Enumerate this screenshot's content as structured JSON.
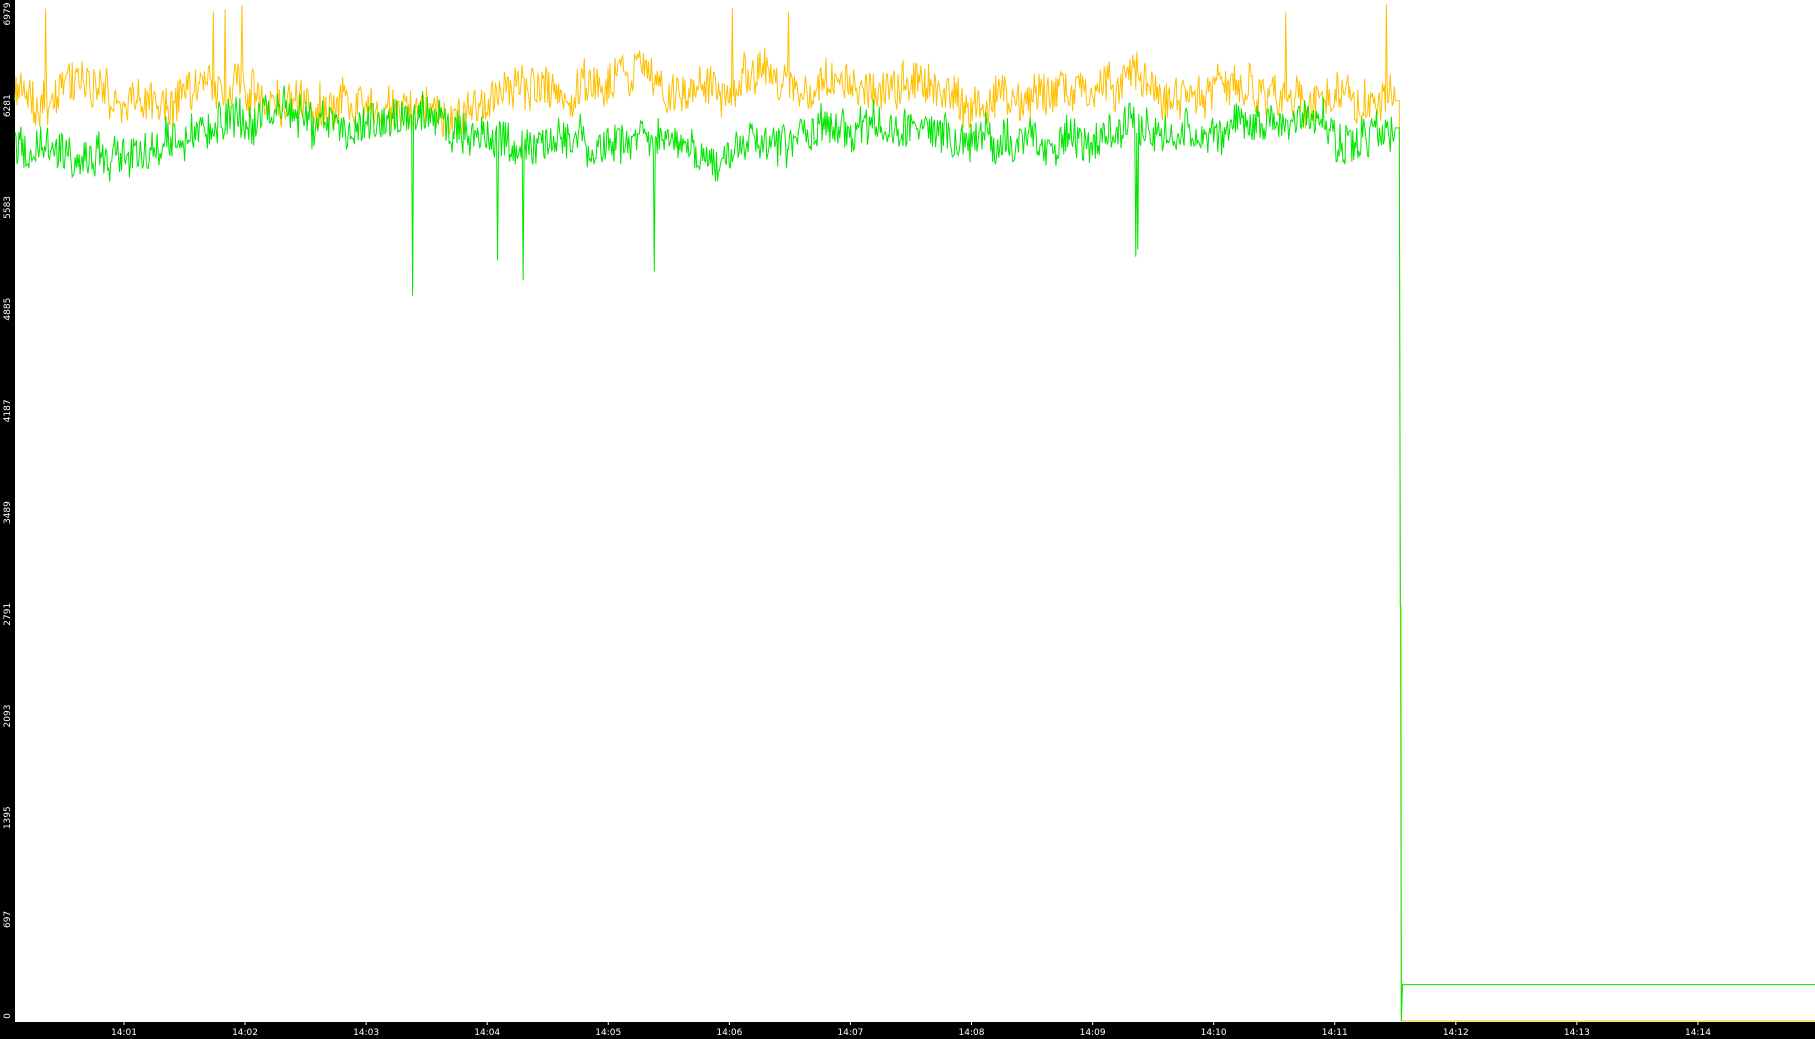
{
  "chart_data": {
    "type": "line",
    "title": "",
    "xlabel": "",
    "ylabel": "",
    "ylim": [
      0,
      6979
    ],
    "y_ticks": [
      "0",
      "697",
      "1395",
      "2093",
      "2791",
      "3489",
      "4187",
      "4885",
      "5583",
      "6281",
      "6979"
    ],
    "x_ticks": [
      "14:01",
      "14:02",
      "14:03",
      "14:04",
      "14:05",
      "14:06",
      "14:07",
      "14:08",
      "14:09",
      "14:10",
      "14:11",
      "14:12",
      "14:13",
      "14:14"
    ],
    "x_range": [
      "14:00:06",
      "14:14:58"
    ],
    "grid": false,
    "legend": "none",
    "background": "#ffffff",
    "axis_color": "#000000",
    "series": [
      {
        "color": "#ffc000",
        "noisy_from": "14:00:06",
        "noisy_to": "14:11:30",
        "noisy_mean": 6390,
        "noisy_spread": 180,
        "noisy_peak": 6979,
        "drop_at": "14:11:33",
        "after_value": 0
      },
      {
        "color": "#00e600",
        "noisy_from": "14:00:06",
        "noisy_to": "14:11:30",
        "noisy_mean": 6080,
        "noisy_spread": 170,
        "noisy_min": 4975,
        "spike_value": 2850,
        "drop_at": "14:11:33",
        "after_value": 250
      }
    ]
  }
}
